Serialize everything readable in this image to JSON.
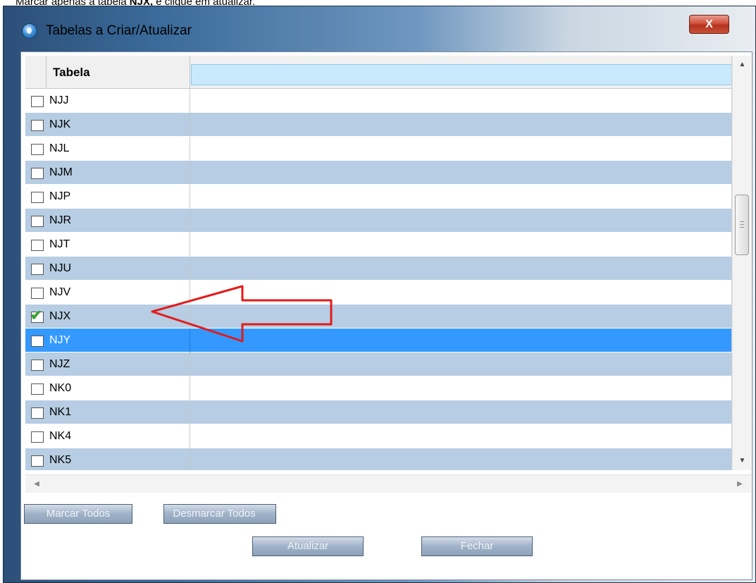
{
  "instruction": {
    "prefix": "Marcar apenas a tabela ",
    "bold": "NJX,",
    "suffix": " e clique em atualizar."
  },
  "window": {
    "title": "Tabelas a Criar/Atualizar",
    "close_label": "X",
    "app_icon": "globe-app-icon"
  },
  "grid": {
    "column_header": "Tabela",
    "rows": [
      {
        "name": "NJJ",
        "checked": false
      },
      {
        "name": "NJK",
        "checked": false
      },
      {
        "name": "NJL",
        "checked": false
      },
      {
        "name": "NJM",
        "checked": false
      },
      {
        "name": "NJP",
        "checked": false
      },
      {
        "name": "NJR",
        "checked": false
      },
      {
        "name": "NJT",
        "checked": false
      },
      {
        "name": "NJU",
        "checked": false
      },
      {
        "name": "NJV",
        "checked": false
      },
      {
        "name": "NJX",
        "checked": true
      },
      {
        "name": "NJY",
        "checked": false,
        "selected": true
      },
      {
        "name": "NJZ",
        "checked": false
      },
      {
        "name": "NK0",
        "checked": false
      },
      {
        "name": "NK1",
        "checked": false
      },
      {
        "name": "NK4",
        "checked": false
      },
      {
        "name": "NK5",
        "checked": false
      }
    ]
  },
  "buttons": {
    "marcar_todos": "Marcar Todos",
    "desmarcar_todos": "Desmarcar Todos",
    "atualizar": "Atualizar",
    "fechar": "Fechar"
  },
  "colors": {
    "row_alt": "#b6cde3",
    "row_selected": "#3399ff",
    "annotation": "#e31b1b",
    "check": "#3aa02b"
  }
}
